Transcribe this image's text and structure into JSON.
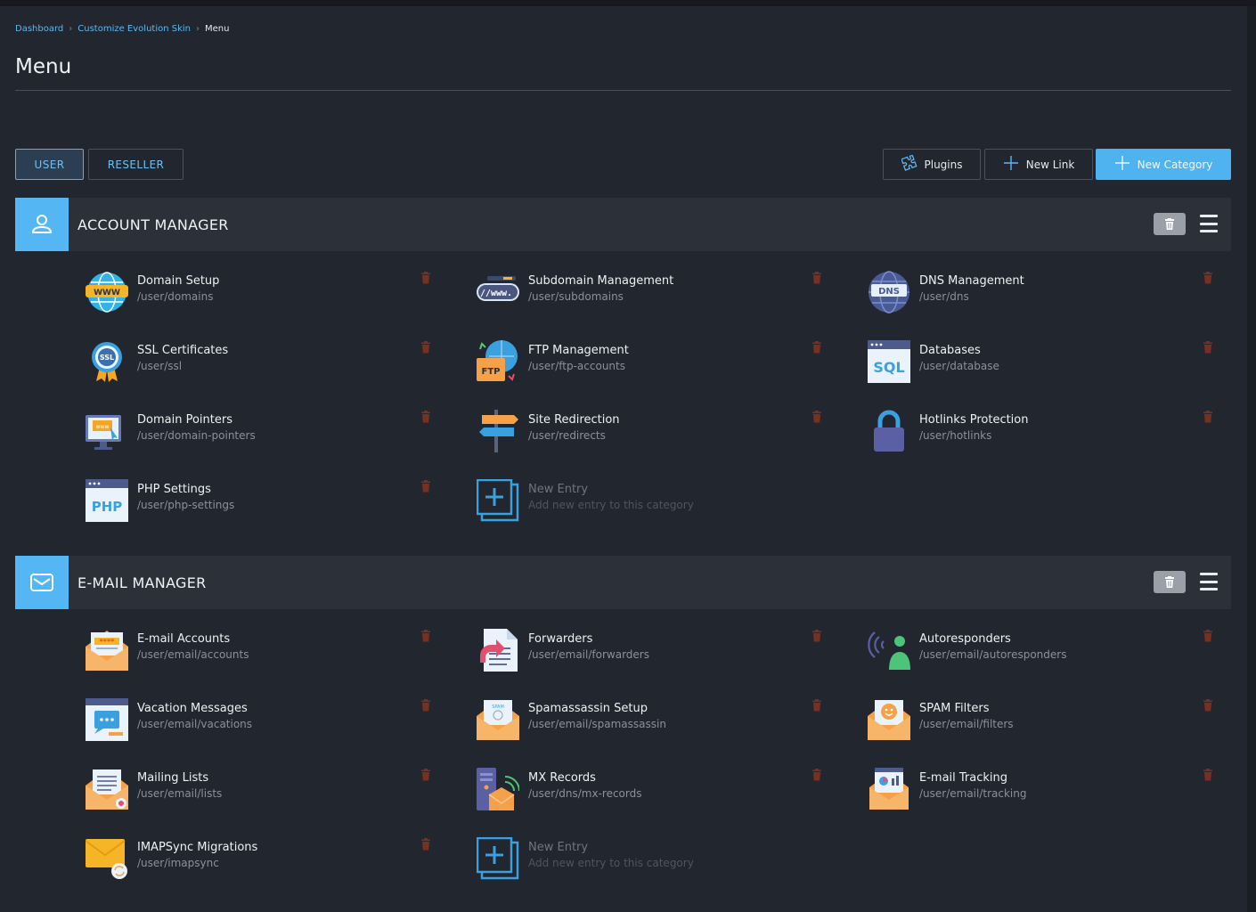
{
  "breadcrumb": {
    "items": [
      "Dashboard",
      "Customize Evolution Skin",
      "Menu"
    ],
    "separator": ">"
  },
  "page": {
    "title": "Menu"
  },
  "tabs": {
    "user": "USER",
    "reseller": "RESELLER",
    "active": "USER"
  },
  "actions": {
    "plugins": "Plugins",
    "new_link": "New Link",
    "new_category": "New Category"
  },
  "colors": {
    "accent": "#4fb3f0",
    "background": "#22262e",
    "category_bar": "#2c3038",
    "delete_icon": "#8b3a2a"
  },
  "categories": [
    {
      "title": "ACCOUNT MANAGER",
      "icon": "user-icon",
      "entries": [
        {
          "name": "Domain Setup",
          "path": "/user/domains",
          "icon": "www-globe-icon"
        },
        {
          "name": "Subdomain Management",
          "path": "/user/subdomains",
          "icon": "www-bar-icon"
        },
        {
          "name": "DNS Management",
          "path": "/user/dns",
          "icon": "dns-globe-icon"
        },
        {
          "name": "SSL Certificates",
          "path": "/user/ssl",
          "icon": "ssl-badge-icon"
        },
        {
          "name": "FTP Management",
          "path": "/user/ftp-accounts",
          "icon": "ftp-folder-icon"
        },
        {
          "name": "Databases",
          "path": "/user/database",
          "icon": "sql-window-icon"
        },
        {
          "name": "Domain Pointers",
          "path": "/user/domain-pointers",
          "icon": "domain-pointer-monitor-icon"
        },
        {
          "name": "Site Redirection",
          "path": "/user/redirects",
          "icon": "signpost-icon"
        },
        {
          "name": "Hotlinks Protection",
          "path": "/user/hotlinks",
          "icon": "padlock-icon"
        },
        {
          "name": "PHP Settings",
          "path": "/user/php-settings",
          "icon": "php-window-icon"
        }
      ],
      "new_entry": {
        "name": "New Entry",
        "path": "Add new entry to this category"
      }
    },
    {
      "title": "E-MAIL MANAGER",
      "icon": "envelope-icon",
      "entries": [
        {
          "name": "E-mail Accounts",
          "path": "/user/email/accounts",
          "icon": "email-password-icon"
        },
        {
          "name": "Forwarders",
          "path": "/user/email/forwarders",
          "icon": "forward-document-icon"
        },
        {
          "name": "Autoresponders",
          "path": "/user/email/autoresponders",
          "icon": "broadcast-person-icon"
        },
        {
          "name": "Vacation Messages",
          "path": "/user/email/vacations",
          "icon": "chat-window-icon"
        },
        {
          "name": "Spamassassin Setup",
          "path": "/user/email/spamassassin",
          "icon": "spam-envelope-icon"
        },
        {
          "name": "SPAM Filters",
          "path": "/user/email/filters",
          "icon": "filter-envelope-icon"
        },
        {
          "name": "Mailing Lists",
          "path": "/user/email/lists",
          "icon": "list-envelope-icon"
        },
        {
          "name": "MX Records",
          "path": "/user/dns/mx-records",
          "icon": "mx-server-icon"
        },
        {
          "name": "E-mail Tracking",
          "path": "/user/email/tracking",
          "icon": "tracking-envelope-icon"
        },
        {
          "name": "IMAPSync Migrations",
          "path": "/user/imapsync",
          "icon": "sync-envelope-icon"
        }
      ],
      "new_entry": {
        "name": "New Entry",
        "path": "Add new entry to this category"
      }
    }
  ]
}
